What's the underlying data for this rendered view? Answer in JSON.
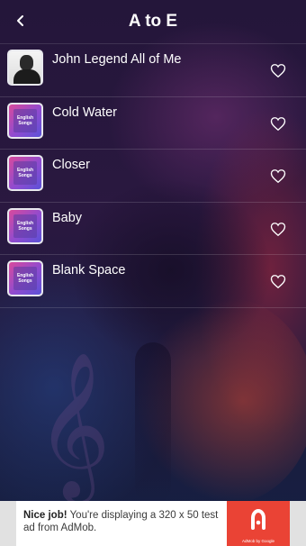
{
  "header": {
    "title": "A to E",
    "back_icon": "chevron-left-icon"
  },
  "songs": [
    {
      "title": "John Legend All of Me",
      "thumb": "artist-photo"
    },
    {
      "title": "Cold Water",
      "thumb": "album-art",
      "thumb_text": [
        "English",
        "Songs"
      ]
    },
    {
      "title": "Closer",
      "thumb": "album-art",
      "thumb_text": [
        "English",
        "Songs"
      ]
    },
    {
      "title": "Baby",
      "thumb": "album-art",
      "thumb_text": [
        "English",
        "Songs"
      ]
    },
    {
      "title": "Blank Space",
      "thumb": "album-art",
      "thumb_text": [
        "English",
        "Songs"
      ]
    }
  ],
  "ad": {
    "headline": "Nice job!",
    "body": "You're displaying a 320 x 50 test ad from AdMob.",
    "brand": "AdMob by Google",
    "accent": "#ea4335"
  }
}
